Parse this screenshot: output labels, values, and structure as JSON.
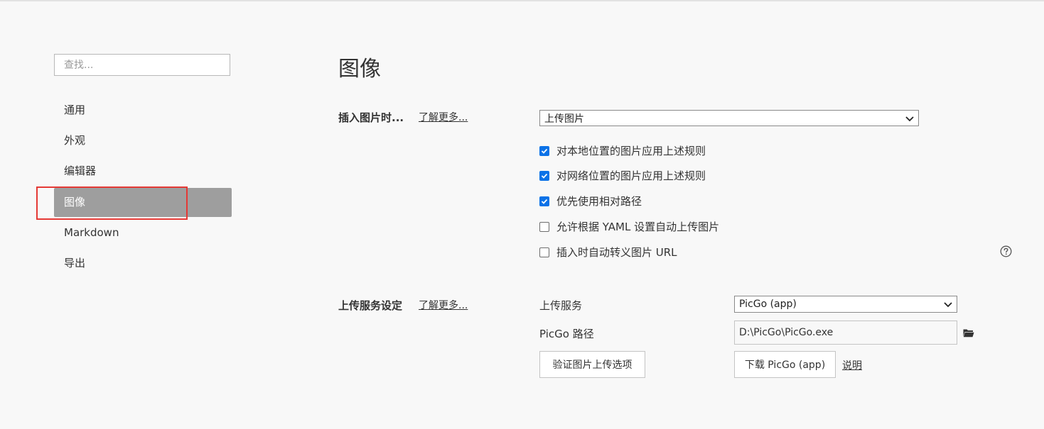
{
  "sidebar": {
    "search_placeholder": "查找...",
    "items": [
      {
        "label": "通用"
      },
      {
        "label": "外观"
      },
      {
        "label": "编辑器"
      },
      {
        "label": "图像"
      },
      {
        "label": "Markdown"
      },
      {
        "label": "导出"
      }
    ],
    "active_index": 3,
    "highlight_color": "#e53935",
    "active_bg": "#9e9e9e"
  },
  "main": {
    "title": "图像",
    "insert_section": {
      "title": "插入图片时...",
      "learn_more": "了解更多...",
      "action_select": "上传图片",
      "checkboxes": [
        {
          "label": "对本地位置的图片应用上述规则",
          "checked": true
        },
        {
          "label": "对网络位置的图片应用上述规则",
          "checked": true
        },
        {
          "label": "优先使用相对路径",
          "checked": true
        },
        {
          "label": "允许根据 YAML 设置自动上传图片",
          "checked": false
        },
        {
          "label": "插入时自动转义图片 URL",
          "checked": false
        }
      ],
      "help_icon": "question-circle-icon"
    },
    "upload_section": {
      "title": "上传服务设定",
      "learn_more": "了解更多...",
      "service_label": "上传服务",
      "service_select": "PicGo (app)",
      "path_label": "PicGo 路径",
      "path_value": "D:\\PicGo\\PicGo.exe",
      "folder_icon": "folder-icon",
      "verify_button": "验证图片上传选项",
      "download_button": "下载 PicGo (app)",
      "explain_link": "说明"
    },
    "checkbox_color": "#0b72e7"
  }
}
